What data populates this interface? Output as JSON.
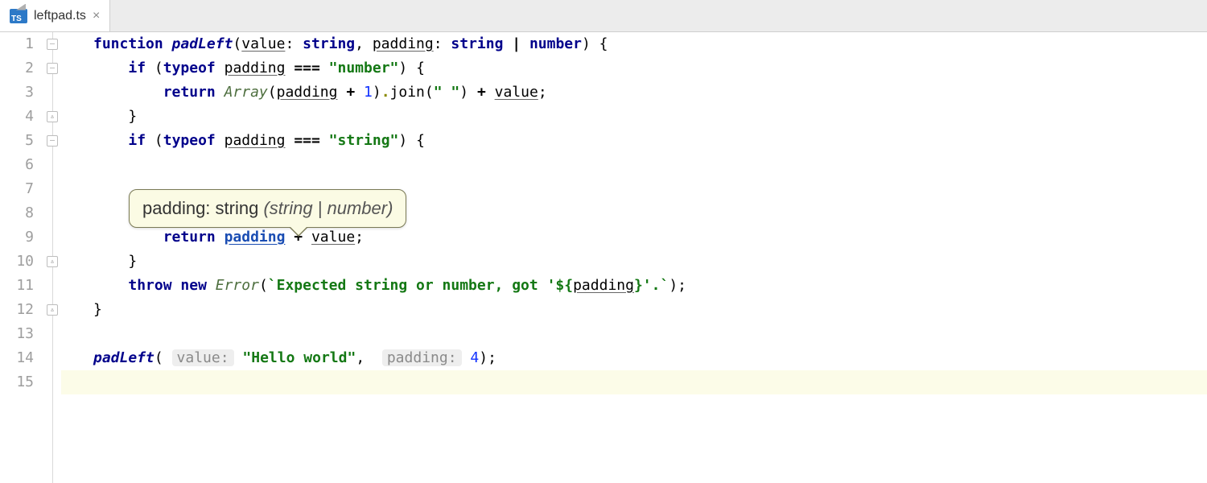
{
  "tab": {
    "filename": "leftpad.ts",
    "icon_label": "TS"
  },
  "gutter": {
    "start": 1,
    "end": 15
  },
  "fold_marks": [
    {
      "line": 1,
      "open": true
    },
    {
      "line": 2,
      "open": true
    },
    {
      "line": 4,
      "open": false,
      "end": true
    },
    {
      "line": 5,
      "open": true
    },
    {
      "line": 10,
      "open": false,
      "end": true
    },
    {
      "line": 12,
      "open": false,
      "end": true
    }
  ],
  "highlight_line": 15,
  "tooltip": {
    "prefix": "padding: string ",
    "italic": "(string | number)",
    "points_to_line": 9
  },
  "code_tokens": {
    "l1": {
      "function": "function",
      "name": "padLeft",
      "p1": "value",
      "t1": "string",
      "p2": "padding",
      "t2a": "string",
      "t2b": "number"
    },
    "l2": {
      "if": "if",
      "typeof": "typeof",
      "ident": "padding",
      "eq": "===",
      "str": "\"number\""
    },
    "l3": {
      "return": "return",
      "Array": "Array",
      "ident": "padding",
      "plus1": "+",
      "one": "1",
      "join": "join",
      "space": "\" \"",
      "plus2": "+",
      "value": "value"
    },
    "l4": {
      "brace": "}"
    },
    "l5": {
      "if": "if",
      "typeof": "typeof",
      "ident": "padding",
      "eq": "===",
      "str": "\"string\""
    },
    "l9": {
      "return": "return",
      "padding": "padding",
      "plus": "+",
      "value": "value"
    },
    "l10": {
      "brace": "}"
    },
    "l11": {
      "throw": "throw",
      "new": "new",
      "Error": "Error",
      "tmpl_a": "`Expected string or number, got '",
      "expr": "padding",
      "tmpl_b": "'.`"
    },
    "l12": {
      "brace": "}"
    },
    "l14": {
      "call": "padLeft",
      "hint1": "value:",
      "arg1": "\"Hello world\"",
      "hint2": "padding:",
      "arg2": "4"
    }
  }
}
